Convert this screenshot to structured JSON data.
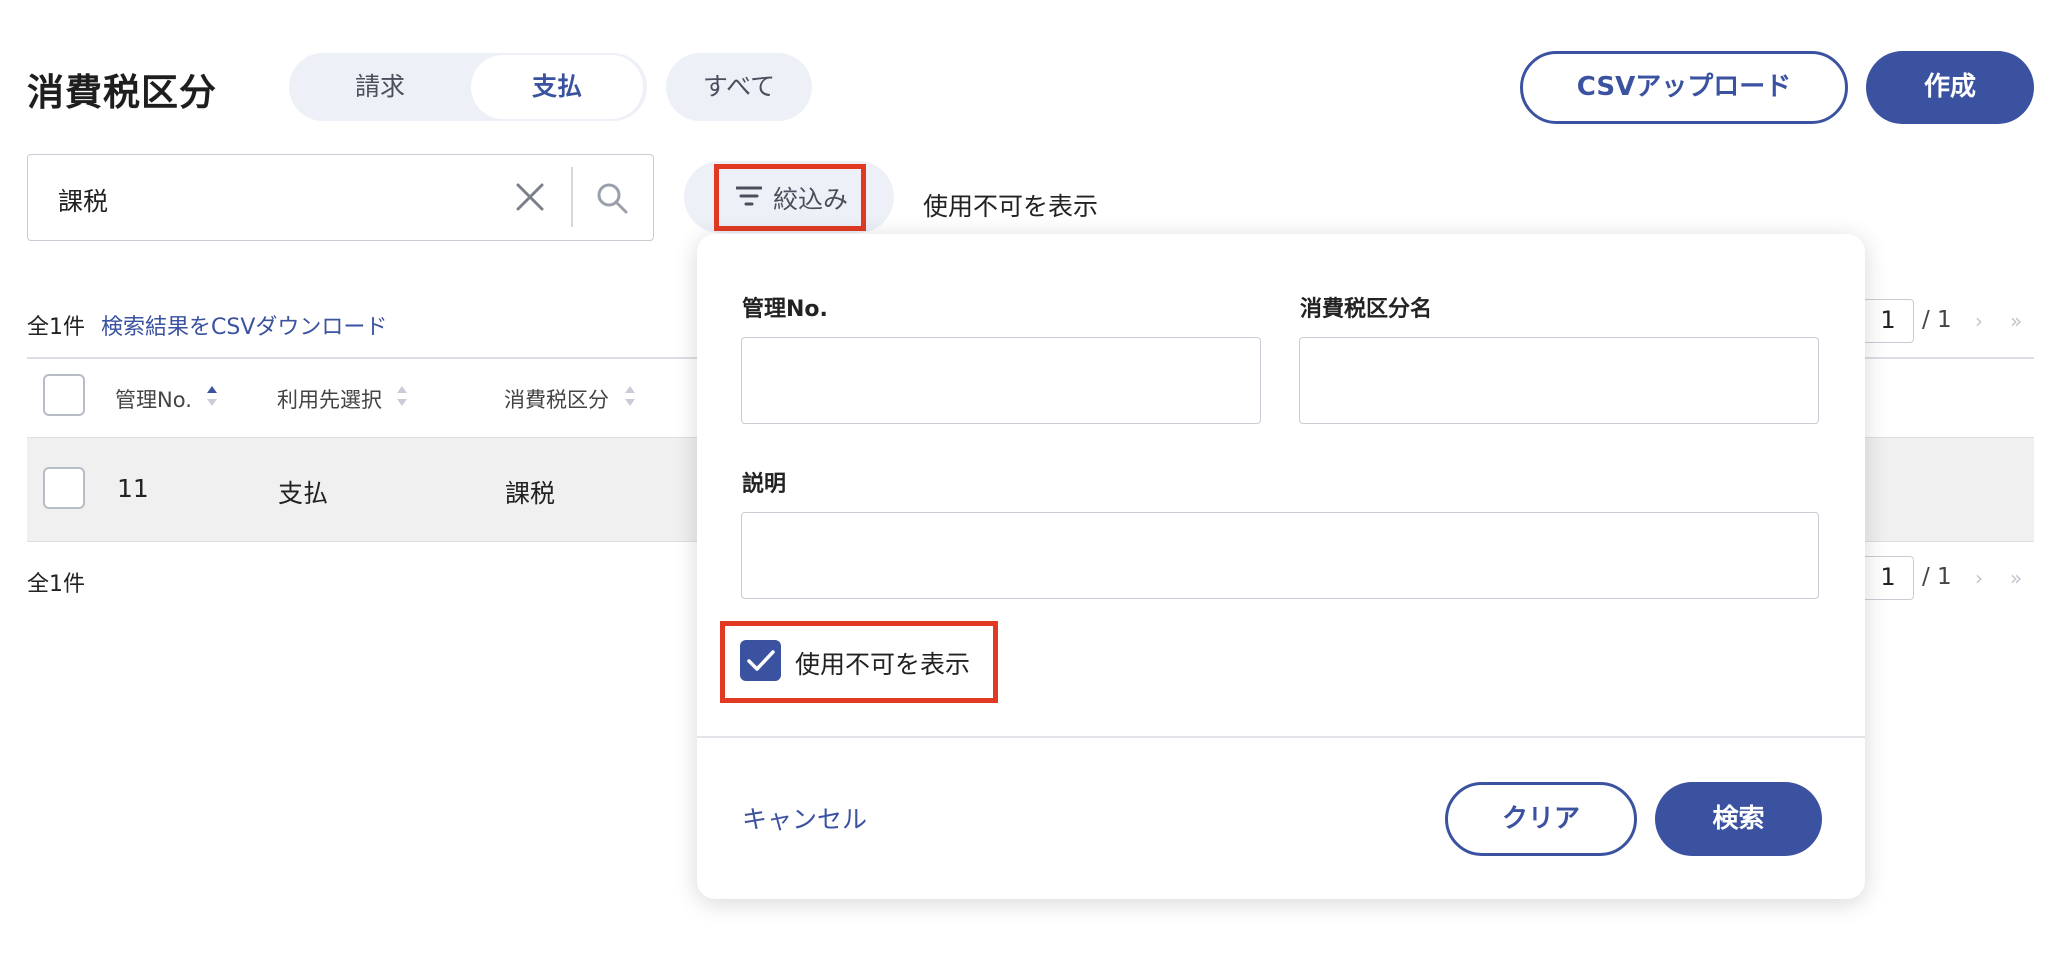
{
  "header": {
    "title": "消費税区分",
    "tabs": [
      {
        "label": "請求"
      },
      {
        "label": "支払"
      }
    ],
    "all_label": "すべて",
    "csv_upload_label": "CSVアップロード",
    "create_label": "作成"
  },
  "search": {
    "value": "課税"
  },
  "filter": {
    "label": "絞込み",
    "show_disabled_text": "使用不可を表示"
  },
  "list": {
    "count_label": "全1件",
    "csv_download_link": "検索結果をCSVダウンロード",
    "columns": [
      "管理No.",
      "利用先選択",
      "消費税区分"
    ],
    "rows": [
      {
        "no": "11",
        "usage": "支払",
        "category": "課税"
      }
    ],
    "pagination": {
      "current": "1",
      "total": "/ 1",
      "next": "›",
      "last": "»"
    }
  },
  "panel": {
    "management_no_label": "管理No.",
    "tax_category_name_label": "消費税区分名",
    "description_label": "説明",
    "show_disabled_label": "使用不可を表示",
    "show_disabled_checked": true,
    "cancel_label": "キャンセル",
    "clear_label": "クリア",
    "search_label": "検索"
  },
  "colors": {
    "accent": "#3a52a0",
    "highlight": "#e23a22",
    "segment_bg": "#edf0f7"
  }
}
